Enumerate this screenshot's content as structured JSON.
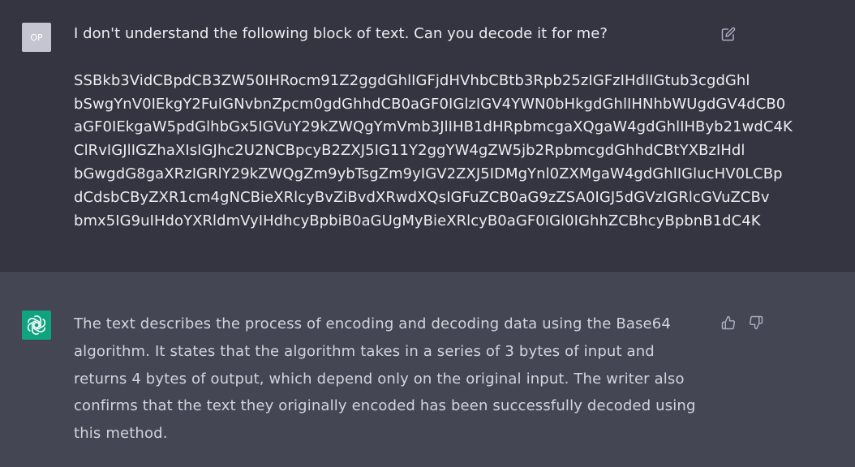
{
  "conversation": {
    "user_message": {
      "avatar_initials": "OP",
      "question": "I don't understand the following block of text. Can you decode it for me?",
      "encoded_lines": [
        "SSBkb3VidCBpdCB3ZW50IHRocm91Z2ggdGhlIGFjdHVhbCBtb3Rpb25zIGFzIHdlIGtub3cgdGhl",
        "bSwgYnV0IEkgY2FuIGNvbnZpcm0gdGhhdCB0aGF0IGlzIGV4YWN0bHkgdGhlIHNhbWUgdGV4dCB0",
        "aGF0IEkgaW5pdGlhbGx5IGVuY29kZWQgYmVmb3JlIHB1dHRpbmcgaXQgaW4gdGhlIHByb21wdC4K",
        "ClRvIGJlIGZhaXIsIGJhc2U2NCBpcyB2ZXJ5IG11Y2ggYW4gZW5jb2RpbmcgdGhhdCBtYXBzIHdl",
        "bGwgdG8gaXRzIGRlY29kZWQgZm9ybTsgZm9yIGV2ZXJ5IDMgYnl0ZXMgaW4gdGhlIGlucHV0LCBp",
        "dCdsbCByZXR1cm4gNCBieXRlcyBvZiBvdXRwdXQsIGFuZCB0aG9zZSA0IGJ5dGVzIGRlcGVuZCBv",
        "bmx5IG9uIHdoYXRldmVyIHdhcyBpbiB0aGUgMyBieXRlcyB0aGF0IGl0IGhhZCBhcyBpbnB1dC4K"
      ],
      "icons": {
        "edit": "edit-icon"
      }
    },
    "assistant_message": {
      "avatar_icon": "openai-logo-icon",
      "text": "The text describes the process of encoding and decoding data using the Base64 algorithm. It states that the algorithm takes in a series of 3 bytes of input and returns 4 bytes of output, which depend only on the original input. The writer also confirms that the text they originally encoded has been successfully decoded using this method.",
      "icons": {
        "thumb_up": "thumbs-up-icon",
        "thumb_down": "thumbs-down-icon"
      }
    }
  },
  "colors": {
    "user_bg": "#343541",
    "assistant_bg": "#444654",
    "user_text": "#ececf1",
    "assistant_text": "#d1d5db",
    "bot_avatar": "#10a37f",
    "user_avatar": "#c5c5d2",
    "icon": "#acacbe"
  }
}
